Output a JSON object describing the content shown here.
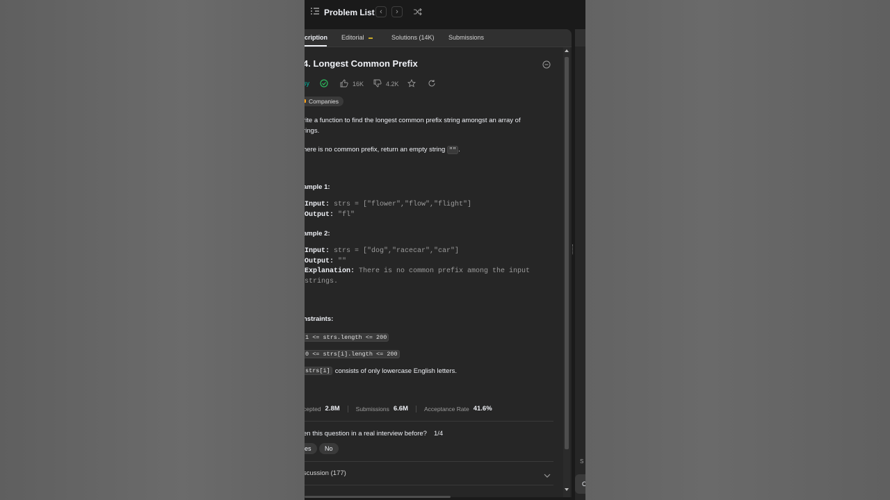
{
  "topbar": {
    "problem_list_label": "Problem List",
    "prev_glyph": "‹",
    "next_glyph": "›"
  },
  "tabs": [
    {
      "label": "cription",
      "active": true
    },
    {
      "label": "Editorial",
      "active": false
    },
    {
      "label": "Solutions (14K)",
      "active": false
    },
    {
      "label": "Submissions",
      "active": false
    }
  ],
  "problem": {
    "title": "4. Longest Common Prefix",
    "difficulty": "sy",
    "likes": "16K",
    "dislikes": "4.2K",
    "companies_label": "Companies",
    "description_line1": "rite a function to find the longest common prefix string amongst an array of",
    "description_line2": "rings.",
    "description2_before": "here is no common prefix, return an empty string ",
    "description2_code": "\"\"",
    "description2_after": "."
  },
  "examples": [
    {
      "heading": "ample 1:",
      "input_label": "Input:",
      "input_value": " strs = [\"flower\",\"flow\",\"flight\"]",
      "output_label": "Output:",
      "output_value": " \"fl\""
    },
    {
      "heading": "ample 2:",
      "input_label": "Input:",
      "input_value": " strs = [\"dog\",\"racecar\",\"car\"]",
      "output_label": "Output:",
      "output_value": " \"\"",
      "explanation_label": "Explanation:",
      "explanation_value": " There is no common prefix among the input",
      "explanation_line2": "strings."
    }
  ],
  "constraints": {
    "heading": "nstraints:",
    "c1": "1 <= strs.length <= 200",
    "c2": "0 <= strs[i].length <= 200",
    "c3_code": "strs[i]",
    "c3_text": "consists of only lowercase English letters."
  },
  "stats": {
    "accepted_label": "cepted",
    "accepted_value": "2.8M",
    "submissions_label": "Submissions",
    "submissions_value": "6.6M",
    "rate_label": "Acceptance Rate",
    "rate_value": "41.6%"
  },
  "interview": {
    "question": "en this question in a real interview before?",
    "fraction": "1/4",
    "yes_label": "es",
    "no_label": "No"
  },
  "discussion": {
    "label": "scussion (177)"
  },
  "right_pane": {
    "s_text": "S",
    "c_text": "C"
  },
  "colors": {
    "easy": "#00b8a3",
    "accepted_check": "#2cbb5d",
    "background": "#1a1a1a",
    "panel": "#262626"
  }
}
